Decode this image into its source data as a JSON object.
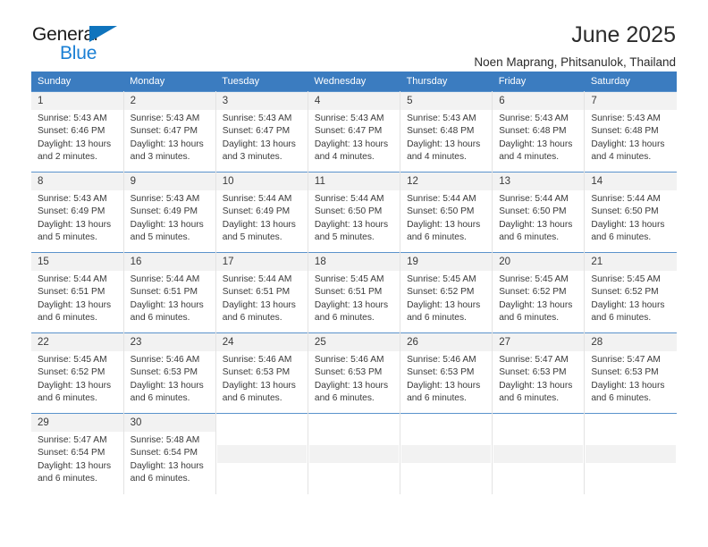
{
  "logo": {
    "word_top": "General",
    "word_bottom": "Blue",
    "triangle_color": "#0f74bd",
    "blue_color": "#1a7fd4"
  },
  "header": {
    "title": "June 2025",
    "subtitle": "Noen Maprang, Phitsanulok, Thailand"
  },
  "theme": {
    "header_band": "#3b7cc0",
    "daynum_strip": "#f2f2f2",
    "row_divider": "#5b93cc",
    "cell_divider": "#e3e3e3",
    "text": "#3a3a3a"
  },
  "calendar": {
    "weekday_headers": [
      "Sunday",
      "Monday",
      "Tuesday",
      "Wednesday",
      "Thursday",
      "Friday",
      "Saturday"
    ],
    "weeks": [
      [
        {
          "day": "1",
          "sunrise": "Sunrise: 5:43 AM",
          "sunset": "Sunset: 6:46 PM",
          "daylight_1": "Daylight: 13 hours",
          "daylight_2": "and 2 minutes."
        },
        {
          "day": "2",
          "sunrise": "Sunrise: 5:43 AM",
          "sunset": "Sunset: 6:47 PM",
          "daylight_1": "Daylight: 13 hours",
          "daylight_2": "and 3 minutes."
        },
        {
          "day": "3",
          "sunrise": "Sunrise: 5:43 AM",
          "sunset": "Sunset: 6:47 PM",
          "daylight_1": "Daylight: 13 hours",
          "daylight_2": "and 3 minutes."
        },
        {
          "day": "4",
          "sunrise": "Sunrise: 5:43 AM",
          "sunset": "Sunset: 6:47 PM",
          "daylight_1": "Daylight: 13 hours",
          "daylight_2": "and 4 minutes."
        },
        {
          "day": "5",
          "sunrise": "Sunrise: 5:43 AM",
          "sunset": "Sunset: 6:48 PM",
          "daylight_1": "Daylight: 13 hours",
          "daylight_2": "and 4 minutes."
        },
        {
          "day": "6",
          "sunrise": "Sunrise: 5:43 AM",
          "sunset": "Sunset: 6:48 PM",
          "daylight_1": "Daylight: 13 hours",
          "daylight_2": "and 4 minutes."
        },
        {
          "day": "7",
          "sunrise": "Sunrise: 5:43 AM",
          "sunset": "Sunset: 6:48 PM",
          "daylight_1": "Daylight: 13 hours",
          "daylight_2": "and 4 minutes."
        }
      ],
      [
        {
          "day": "8",
          "sunrise": "Sunrise: 5:43 AM",
          "sunset": "Sunset: 6:49 PM",
          "daylight_1": "Daylight: 13 hours",
          "daylight_2": "and 5 minutes."
        },
        {
          "day": "9",
          "sunrise": "Sunrise: 5:43 AM",
          "sunset": "Sunset: 6:49 PM",
          "daylight_1": "Daylight: 13 hours",
          "daylight_2": "and 5 minutes."
        },
        {
          "day": "10",
          "sunrise": "Sunrise: 5:44 AM",
          "sunset": "Sunset: 6:49 PM",
          "daylight_1": "Daylight: 13 hours",
          "daylight_2": "and 5 minutes."
        },
        {
          "day": "11",
          "sunrise": "Sunrise: 5:44 AM",
          "sunset": "Sunset: 6:50 PM",
          "daylight_1": "Daylight: 13 hours",
          "daylight_2": "and 5 minutes."
        },
        {
          "day": "12",
          "sunrise": "Sunrise: 5:44 AM",
          "sunset": "Sunset: 6:50 PM",
          "daylight_1": "Daylight: 13 hours",
          "daylight_2": "and 6 minutes."
        },
        {
          "day": "13",
          "sunrise": "Sunrise: 5:44 AM",
          "sunset": "Sunset: 6:50 PM",
          "daylight_1": "Daylight: 13 hours",
          "daylight_2": "and 6 minutes."
        },
        {
          "day": "14",
          "sunrise": "Sunrise: 5:44 AM",
          "sunset": "Sunset: 6:50 PM",
          "daylight_1": "Daylight: 13 hours",
          "daylight_2": "and 6 minutes."
        }
      ],
      [
        {
          "day": "15",
          "sunrise": "Sunrise: 5:44 AM",
          "sunset": "Sunset: 6:51 PM",
          "daylight_1": "Daylight: 13 hours",
          "daylight_2": "and 6 minutes."
        },
        {
          "day": "16",
          "sunrise": "Sunrise: 5:44 AM",
          "sunset": "Sunset: 6:51 PM",
          "daylight_1": "Daylight: 13 hours",
          "daylight_2": "and 6 minutes."
        },
        {
          "day": "17",
          "sunrise": "Sunrise: 5:44 AM",
          "sunset": "Sunset: 6:51 PM",
          "daylight_1": "Daylight: 13 hours",
          "daylight_2": "and 6 minutes."
        },
        {
          "day": "18",
          "sunrise": "Sunrise: 5:45 AM",
          "sunset": "Sunset: 6:51 PM",
          "daylight_1": "Daylight: 13 hours",
          "daylight_2": "and 6 minutes."
        },
        {
          "day": "19",
          "sunrise": "Sunrise: 5:45 AM",
          "sunset": "Sunset: 6:52 PM",
          "daylight_1": "Daylight: 13 hours",
          "daylight_2": "and 6 minutes."
        },
        {
          "day": "20",
          "sunrise": "Sunrise: 5:45 AM",
          "sunset": "Sunset: 6:52 PM",
          "daylight_1": "Daylight: 13 hours",
          "daylight_2": "and 6 minutes."
        },
        {
          "day": "21",
          "sunrise": "Sunrise: 5:45 AM",
          "sunset": "Sunset: 6:52 PM",
          "daylight_1": "Daylight: 13 hours",
          "daylight_2": "and 6 minutes."
        }
      ],
      [
        {
          "day": "22",
          "sunrise": "Sunrise: 5:45 AM",
          "sunset": "Sunset: 6:52 PM",
          "daylight_1": "Daylight: 13 hours",
          "daylight_2": "and 6 minutes."
        },
        {
          "day": "23",
          "sunrise": "Sunrise: 5:46 AM",
          "sunset": "Sunset: 6:53 PM",
          "daylight_1": "Daylight: 13 hours",
          "daylight_2": "and 6 minutes."
        },
        {
          "day": "24",
          "sunrise": "Sunrise: 5:46 AM",
          "sunset": "Sunset: 6:53 PM",
          "daylight_1": "Daylight: 13 hours",
          "daylight_2": "and 6 minutes."
        },
        {
          "day": "25",
          "sunrise": "Sunrise: 5:46 AM",
          "sunset": "Sunset: 6:53 PM",
          "daylight_1": "Daylight: 13 hours",
          "daylight_2": "and 6 minutes."
        },
        {
          "day": "26",
          "sunrise": "Sunrise: 5:46 AM",
          "sunset": "Sunset: 6:53 PM",
          "daylight_1": "Daylight: 13 hours",
          "daylight_2": "and 6 minutes."
        },
        {
          "day": "27",
          "sunrise": "Sunrise: 5:47 AM",
          "sunset": "Sunset: 6:53 PM",
          "daylight_1": "Daylight: 13 hours",
          "daylight_2": "and 6 minutes."
        },
        {
          "day": "28",
          "sunrise": "Sunrise: 5:47 AM",
          "sunset": "Sunset: 6:53 PM",
          "daylight_1": "Daylight: 13 hours",
          "daylight_2": "and 6 minutes."
        }
      ],
      [
        {
          "day": "29",
          "sunrise": "Sunrise: 5:47 AM",
          "sunset": "Sunset: 6:54 PM",
          "daylight_1": "Daylight: 13 hours",
          "daylight_2": "and 6 minutes."
        },
        {
          "day": "30",
          "sunrise": "Sunrise: 5:48 AM",
          "sunset": "Sunset: 6:54 PM",
          "daylight_1": "Daylight: 13 hours",
          "daylight_2": "and 6 minutes."
        },
        null,
        null,
        null,
        null,
        null
      ]
    ]
  }
}
